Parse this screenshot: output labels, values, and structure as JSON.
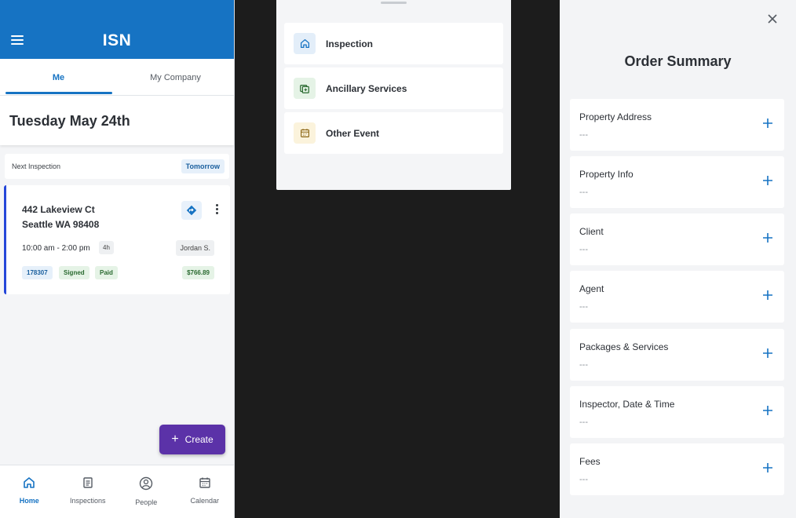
{
  "home": {
    "logo": "ISN",
    "tabs": [
      "Me",
      "My Company"
    ],
    "date_heading": "Tuesday May 24th",
    "next_label": "Next Inspection",
    "next_badge": "Tomorrow",
    "inspection": {
      "address_line1": "442 Lakeview Ct",
      "address_line2": "Seattle WA 98408",
      "time": "10:00 am - 2:00 pm",
      "duration": "4h",
      "inspector": "Jordan S.",
      "id": "178307",
      "signed": "Signed",
      "paid": "Paid",
      "price": "$766.89"
    },
    "fab_label": "Create",
    "nav": [
      "Home",
      "Inspections",
      "People",
      "Calendar"
    ]
  },
  "event_sheet": {
    "options": [
      "Inspection",
      "Ancillary Services",
      "Other Event"
    ]
  },
  "summary": {
    "title": "Order Summary",
    "sections": [
      {
        "title": "Property Address",
        "value": "---"
      },
      {
        "title": "Property Info",
        "value": "---"
      },
      {
        "title": "Client",
        "value": "---"
      },
      {
        "title": "Agent",
        "value": "---"
      },
      {
        "title": "Packages & Services",
        "value": "---"
      },
      {
        "title": "Inspector, Date & Time",
        "value": "---"
      },
      {
        "title": "Fees",
        "value": "---"
      }
    ]
  },
  "colors": {
    "brand": "#1673c3",
    "accent": "#5b32a8",
    "success": "#2a6a30"
  }
}
